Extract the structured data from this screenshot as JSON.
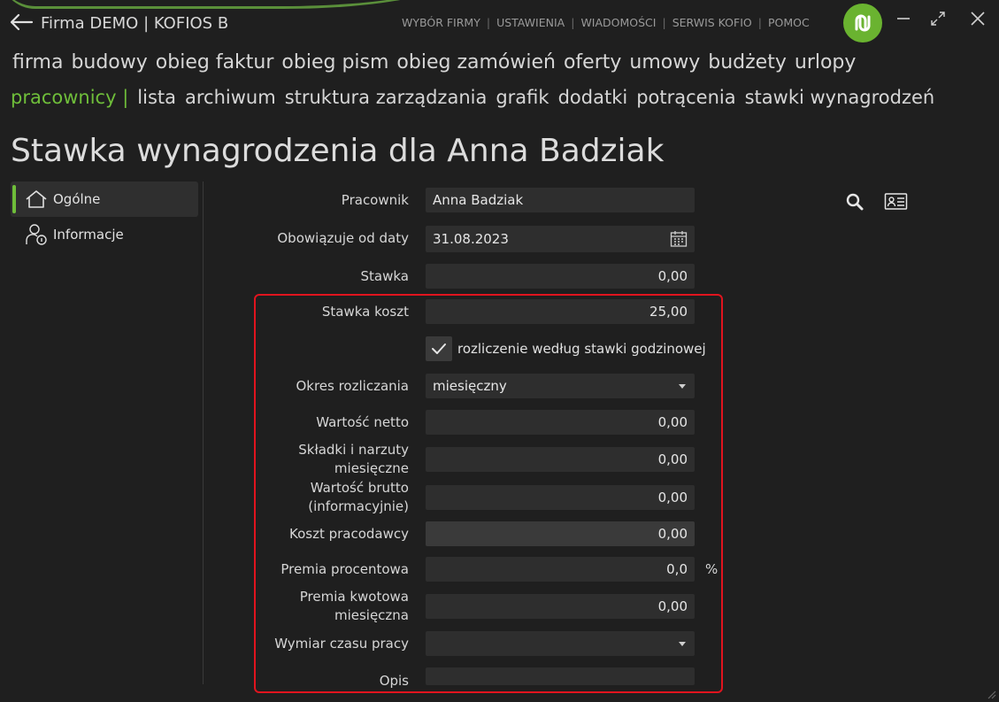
{
  "header": {
    "title": "Firma DEMO | KOFIOS B",
    "nav": [
      "WYBÓR FIRMY",
      "USTAWIENIA",
      "WIADOMOŚCI",
      "SERWIS KOFIO",
      "POMOC"
    ]
  },
  "menu_primary": [
    "firma",
    "budowy",
    "obieg faktur",
    "obieg pism",
    "obieg zamówień",
    "oferty",
    "umowy",
    "budżety",
    "urlopy"
  ],
  "menu_secondary": {
    "active": "pracownicy |",
    "items": [
      "lista",
      "archiwum",
      "struktura zarządzania",
      "grafik",
      "dodatki",
      "potrącenia",
      "stawki wynagrodzeń"
    ]
  },
  "page_title": "Stawka wynagrodzenia dla Anna Badziak",
  "sidebar": [
    {
      "label": "Ogólne",
      "icon": "home-icon"
    },
    {
      "label": "Informacje",
      "icon": "user-info-icon"
    }
  ],
  "form": {
    "pracownik_label": "Pracownik",
    "pracownik_value": "Anna Badziak",
    "data_label": "Obowiązuje od daty",
    "data_value": "31.08.2023",
    "stawka_label": "Stawka",
    "stawka_value": "0,00",
    "stawka_koszt_label": "Stawka koszt",
    "stawka_koszt_value": "25,00",
    "godzinowa_label": "rozliczenie według stawki godzinowej",
    "okres_label": "Okres rozliczania",
    "okres_value": "miesięczny",
    "netto_label": "Wartość netto",
    "netto_value": "0,00",
    "skladki_label_1": "Składki i narzuty",
    "skladki_label_2": "miesięczne",
    "skladki_value": "0,00",
    "brutto_label_1": "Wartość brutto",
    "brutto_label_2": "(informacyjnie)",
    "brutto_value": "0,00",
    "koszt_label": "Koszt pracodawcy",
    "koszt_value": "0,00",
    "premia_proc_label": "Premia procentowa",
    "premia_proc_value": "0,0",
    "premia_proc_unit": "%",
    "premia_kw_label_1": "Premia kwotowa",
    "premia_kw_label_2": "miesięczna",
    "premia_kw_value": "0,00",
    "wymiar_label": "Wymiar czasu pracy",
    "wymiar_value": "",
    "opis_label": "Opis"
  },
  "colors": {
    "accent": "#6fbe3a",
    "highlight": "#e0141e",
    "background": "#1f1f1f"
  }
}
